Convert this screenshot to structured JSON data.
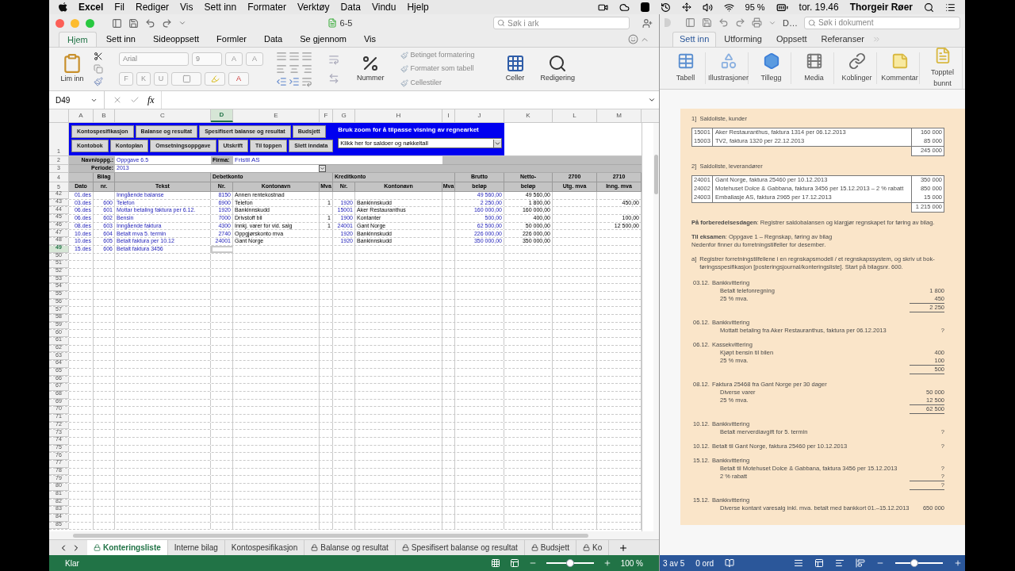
{
  "menubar": {
    "app": "Excel",
    "items": [
      "Fil",
      "Rediger",
      "Vis",
      "Sett inn",
      "Formater",
      "Verktøy",
      "Data",
      "Vindu",
      "Hjelp"
    ],
    "battery": "95 %",
    "clock": "tor. 19.46",
    "user": "Thorgeir Røer"
  },
  "excel": {
    "title": "6-5",
    "search_placeholder": "Søk i ark",
    "tabs": [
      {
        "label": "Hjem",
        "selected": true
      },
      {
        "label": "Sett inn",
        "selected": false
      },
      {
        "label": "Sideoppsett",
        "selected": false
      },
      {
        "label": "Formler",
        "selected": false
      },
      {
        "label": "Data",
        "selected": false
      },
      {
        "label": "Se gjennom",
        "selected": false
      },
      {
        "label": "Vis",
        "selected": false
      }
    ],
    "ribbon": {
      "paste": "Lim inn",
      "font": "Arial",
      "size": "9",
      "grow": "A",
      "shrink": "A",
      "style_buttons": [
        "F",
        "K",
        "U"
      ],
      "font_color": "A",
      "number": "Nummer",
      "styles": [
        "Betinget formatering",
        "Formater som tabell",
        "Cellestiler"
      ],
      "cells": "Celler",
      "editing": "Redigering"
    },
    "formula_bar": {
      "name_box": "D49",
      "fx": "fx"
    },
    "columns": [
      {
        "label": "A",
        "selected": false
      },
      {
        "label": "B",
        "selected": false
      },
      {
        "label": "C",
        "selected": false
      },
      {
        "label": "D",
        "selected": true
      },
      {
        "label": "E",
        "selected": false
      },
      {
        "label": "F",
        "selected": false
      },
      {
        "label": "G",
        "selected": false
      },
      {
        "label": "H",
        "selected": false
      },
      {
        "label": "I",
        "selected": false
      },
      {
        "label": "J",
        "selected": false
      },
      {
        "label": "K",
        "selected": false
      },
      {
        "label": "L",
        "selected": false
      },
      {
        "label": "M",
        "selected": false
      }
    ],
    "nav_buttons": [
      [
        "Kontospesifikasjon",
        "Balanse og resultat",
        "Spesifisert balanse og resultat",
        "Budsjett"
      ],
      [
        "Kontobok",
        "Kontoplan",
        "Omsetningsoppgave",
        "Utskrift",
        "Til toppen",
        "Slett inndata"
      ]
    ],
    "zoom_hint": "Bruk zoom for å tilpasse visning av regnearket",
    "dropdown": "Klikk her for saldoer og nøkkeltall",
    "head_rows": [
      "1",
      "2",
      "3",
      "4",
      "5"
    ],
    "info": {
      "name_label": "Navn/oppg.:",
      "name": "Oppgave 6.5",
      "period_label": "Periode:",
      "period": "2013",
      "firm_label": "Firma:",
      "firm": "Fristil AS"
    },
    "header4": {
      "B": "Bilag",
      "D": "Debetkonto",
      "G": "Kreditkonto",
      "J": "Brutto",
      "K": "Netto-",
      "L": "2700",
      "M": "2710"
    },
    "header5": {
      "A": "Dato",
      "B": "nr.",
      "C": "Tekst",
      "D": "Nr.",
      "E": "Kontonavn",
      "F": "Mva",
      "G": "Nr.",
      "H": "Kontonavn",
      "I": "Mva",
      "J": "beløp",
      "K": "beløp",
      "L": "Utg. mva",
      "M": "Inng. mva"
    },
    "rows": [
      {
        "row": "42",
        "selected": false,
        "cells": {
          "A": "01.des",
          "C": "Inngående balanse",
          "D": "8150",
          "E": "Annen rentekostnad",
          "J": "49 560,00",
          "K": "49 560,00"
        }
      },
      {
        "row": "43",
        "selected": false,
        "cells": {
          "A": "03.des",
          "B": "600",
          "C": "Telefon",
          "D": "6900",
          "E": "Telefon",
          "F": "1",
          "G": "1920",
          "H": "Bankinnskudd",
          "J": "2 250,00",
          "K": "1 800,00",
          "M": "450,00"
        }
      },
      {
        "row": "44",
        "selected": false,
        "cells": {
          "A": "06.des",
          "B": "601",
          "C": "Mottar betaling faktura per 6.12.",
          "D": "1920",
          "E": "Bankinnskudd",
          "G": "15001",
          "H": "Aker Restauranthus",
          "J": "160 000,00",
          "K": "160 000,00"
        }
      },
      {
        "row": "45",
        "selected": false,
        "cells": {
          "A": "06.des",
          "B": "602",
          "C": "Bensin",
          "D": "7000",
          "E": "Drivstoff bil",
          "F": "1",
          "G": "1900",
          "H": "Kontanter",
          "J": "500,00",
          "K": "400,00",
          "M": "100,00"
        }
      },
      {
        "row": "46",
        "selected": false,
        "cells": {
          "A": "08.des",
          "B": "603",
          "C": "Inngående faktura",
          "D": "4300",
          "E": "Innkj. varer for vid. salg",
          "F": "1",
          "G": "24001",
          "H": "Gant Norge",
          "J": "62 500,00",
          "K": "50 000,00",
          "M": "12 500,00"
        }
      },
      {
        "row": "47",
        "selected": false,
        "cells": {
          "A": "10.des",
          "B": "604",
          "C": "Betalt mva 5. termin",
          "D": "2740",
          "E": "Oppgjørskonto mva",
          "G": "1920",
          "H": "Bankinnskudd",
          "J": "226 000,00",
          "K": "226 000,00"
        }
      },
      {
        "row": "48",
        "selected": false,
        "cells": {
          "A": "10.des",
          "B": "605",
          "C": "Betalt faktura per 10.12",
          "D": "24001",
          "E": "Gant Norge",
          "G": "1920",
          "H": "Bankinnskudd",
          "J": "350 000,00",
          "K": "350 000,00"
        }
      },
      {
        "row": "49",
        "selected": true,
        "cells": {
          "A": "15.des",
          "B": "606",
          "C": "Betalt faktura 3456"
        }
      }
    ],
    "empty_rows": [
      "50",
      "51",
      "52",
      "53",
      "54",
      "55",
      "56",
      "57",
      "58",
      "59",
      "60",
      "61",
      "62",
      "63",
      "64",
      "65",
      "66",
      "67",
      "68",
      "69",
      "70",
      "71",
      "72",
      "73",
      "74",
      "75",
      "76",
      "77",
      "78",
      "79",
      "80",
      "81",
      "82",
      "83",
      "84",
      "85"
    ],
    "sheet_tabs": [
      {
        "label": "Konteringsliste",
        "locked": true,
        "selected": true
      },
      {
        "label": "Interne bilag",
        "locked": false,
        "selected": false
      },
      {
        "label": "Kontospesifikasjon",
        "locked": false,
        "selected": false
      },
      {
        "label": "Balanse og resultat",
        "locked": true,
        "selected": false
      },
      {
        "label": "Spesifisert balanse og resultat",
        "locked": true,
        "selected": false
      },
      {
        "label": "Budsjett",
        "locked": true,
        "selected": false
      },
      {
        "label": "Ko",
        "locked": true,
        "selected": false
      }
    ],
    "status": "Klar",
    "zoom": "100 %",
    "zoom_slider": {
      "level": 0.5
    }
  },
  "word": {
    "title": "D…",
    "search_placeholder": "Søk i dokument",
    "tabs": [
      {
        "label": "Sett inn",
        "selected": true
      },
      {
        "label": "Utforming",
        "selected": false
      },
      {
        "label": "Oppsett",
        "selected": false
      },
      {
        "label": "Referanser",
        "selected": false
      }
    ],
    "ribbon": [
      {
        "kind": "table",
        "label": "Tabell"
      },
      {
        "kind": "shapes",
        "label": "Illustrasjoner"
      },
      {
        "kind": "addins",
        "label": "Tillegg"
      },
      {
        "kind": "media",
        "label": "Media"
      },
      {
        "kind": "links",
        "label": "Koblinger"
      },
      {
        "kind": "comment",
        "label": "Kommentar"
      },
      {
        "kind": "header",
        "label": "Topptel",
        "label2": "bunnt"
      }
    ],
    "doc": {
      "customers": {
        "heading": "1]  Saldoliste, kunder",
        "rows": [
          {
            "number": "15001",
            "text": "Aker Restauranthus, faktura 1314 per 06.12.2013",
            "amount": "160 000"
          },
          {
            "number": "15003",
            "text": "TV2, faktura 1320 per 22.12.2013",
            "amount": "85 000"
          }
        ],
        "total": "245 000"
      },
      "suppliers": {
        "heading": "2]  Saldoliste, leverandører",
        "rows": [
          {
            "number": "24001",
            "text": "Gant Norge, faktura 25460 per 10.12.2013",
            "amount": "350 000"
          },
          {
            "number": "24002",
            "text": "Motehuset Dolce & Gabbana, faktura 3456 per 15.12.2013 – 2 % rabatt",
            "amount": "850 000"
          },
          {
            "number": "24003",
            "text": "Emballasje AS, faktura 2965 per 17.12.2013",
            "amount": "15 000"
          }
        ],
        "total": "1 215 000"
      },
      "prep": "**På forberedelsesdagen**: Registrer saldobalansen og klargjør regnskapet for føring av bilag.",
      "exam": [
        "**Til eksamen**: Oppgave 1 – Regnskap, føring av bilag",
        "Nedenfor finner du forretningstilfeller for desember."
      ],
      "task_label": "a]",
      "task": "Registrer forretningstilfellene i en regnskapsmodell / et regnskapssystem, og skriv ut bok-føringsspesifikasjon [posteringsjournal/konteringsliste]. Start på bilagsnr. 600.",
      "entries": [
        {
          "date": "03.12.",
          "title": "Bankkvittering",
          "lines": [
            {
              "text": "Betalt telefonregning",
              "amount": "1 800",
              "underline": false
            },
            {
              "text": "25 % mva.",
              "amount": "450",
              "underline": true
            },
            {
              "amount": "2 250",
              "underline": true
            }
          ]
        },
        {
          "date": "06.12.",
          "title": "Bankkvittering",
          "lines": [
            {
              "text": "Mottatt betaling fra Aker Restauranthus, faktura per 06.12.2013",
              "amount": "?",
              "underline": false
            }
          ]
        },
        {
          "date": "06.12.",
          "title": "Kassekvittering",
          "lines": [
            {
              "text": "Kjøpt bensin til bilen",
              "amount": "400",
              "underline": false
            },
            {
              "text": "25 % mva.",
              "amount": "100",
              "underline": true
            },
            {
              "amount": "500",
              "underline": true
            }
          ]
        },
        {
          "date": "08.12.",
          "title": "Faktura 25468 fra Gant Norge per 30 dager",
          "lines": [
            {
              "text": "Diverse varer",
              "amount": "50 000",
              "underline": false
            },
            {
              "text": "25 % mva.",
              "amount": "12 500",
              "underline": true
            },
            {
              "amount": "62 500",
              "underline": true
            }
          ]
        },
        {
          "date": "10.12.",
          "title": "Bankkvittering",
          "lines": [
            {
              "text": "Betalt merverdiavgift for 5. termin",
              "amount": "?",
              "underline": false
            }
          ]
        },
        {
          "date": "10.12.",
          "title": "Betalt til Gant Norge, faktura 25460 per 10.12.2013",
          "amount": "?"
        },
        {
          "date": "15.12.",
          "title": "Bankkvittering",
          "lines": [
            {
              "text": "Betalt til Motehuset Dolce & Gabbana, faktura 3456 per 15.12.2013",
              "amount": "?",
              "underline": false
            },
            {
              "text": "2 % rabatt",
              "amount": "?",
              "underline": true
            },
            {
              "amount": "?",
              "underline": true
            }
          ]
        },
        {
          "date": "15.12.",
          "title": "Bankkvittering",
          "lines": [
            {
              "text": "Diverse kontant varesalg inkl. mva. betalt med bankkort 01.–15.12.2013",
              "amount": "650 000",
              "underline": false
            }
          ]
        }
      ]
    },
    "status": {
      "page": "3 av 5",
      "words": "0 ord"
    },
    "zoom_slider": {
      "level": 0.4
    }
  }
}
